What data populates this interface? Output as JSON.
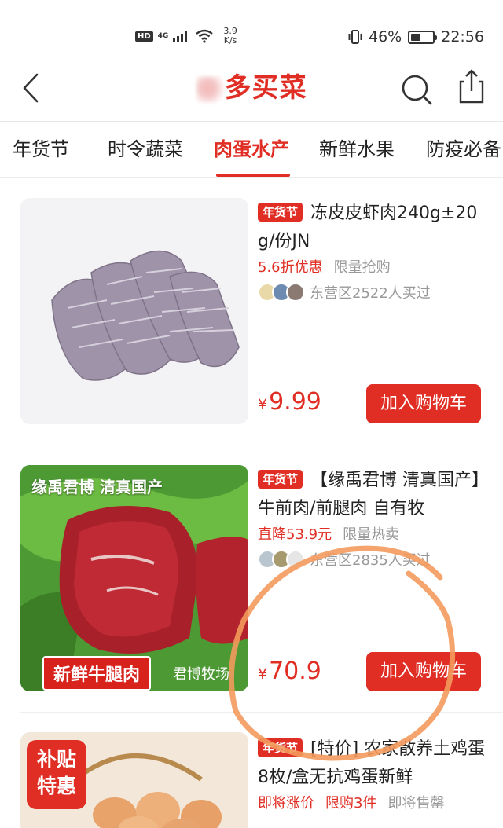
{
  "status_bar": {
    "hd": "HD",
    "network": "4G",
    "speed_value": "3.9",
    "speed_unit": "K/s",
    "battery": "46%",
    "battery_level": 0.46,
    "time": "22:56"
  },
  "header": {
    "title": "多买菜"
  },
  "tabs": [
    {
      "label": "年货节"
    },
    {
      "label": "时令蔬菜"
    },
    {
      "label": "肉蛋水产"
    },
    {
      "label": "新鲜水果"
    },
    {
      "label": "防疫必备"
    }
  ],
  "active_tab_index": 2,
  "products": [
    {
      "tag": "年货节",
      "title": "冻皮皮虾肉240g±20g/份JN",
      "promos": [
        {
          "text": "5.6折优惠",
          "color": "red"
        },
        {
          "text": "限量抢购",
          "color": "gray"
        }
      ],
      "buyers": "东营区2522人买过",
      "currency": "¥",
      "price": "9.99",
      "cart_label": "加入购物车"
    },
    {
      "tag": "年货节",
      "title": "【缘禹君博 清真国产】牛前肉/前腿肉 自有牧",
      "promos": [
        {
          "text": "直降53.9元",
          "color": "red"
        },
        {
          "text": "限量热卖",
          "color": "gray"
        }
      ],
      "buyers": "东营区2835人买过",
      "currency": "¥",
      "price": "70.9",
      "cart_label": "加入购物车",
      "image_caption_top": "缘禹君博 清真国产",
      "image_caption_badge": "新鲜牛腿肉",
      "image_caption_small": "君博牧场"
    },
    {
      "tag": "年货节",
      "title": "[特价] 农家散养土鸡蛋8枚/盒无抗鸡蛋新鲜",
      "promos": [
        {
          "text": "即将涨价",
          "color": "red"
        },
        {
          "text": "限购3件",
          "color": "red"
        },
        {
          "text": "即将售罄",
          "color": "gray"
        }
      ],
      "image_badge_line1": "补贴",
      "image_badge_line2": "特惠"
    }
  ],
  "colors": {
    "brand_red": "#e02e24",
    "annotation_orange": "#f39a5c"
  },
  "icons": [
    "back-arrow-icon",
    "search-icon",
    "share-icon",
    "wifi-icon",
    "signal-icon",
    "vibrate-icon",
    "battery-icon"
  ]
}
